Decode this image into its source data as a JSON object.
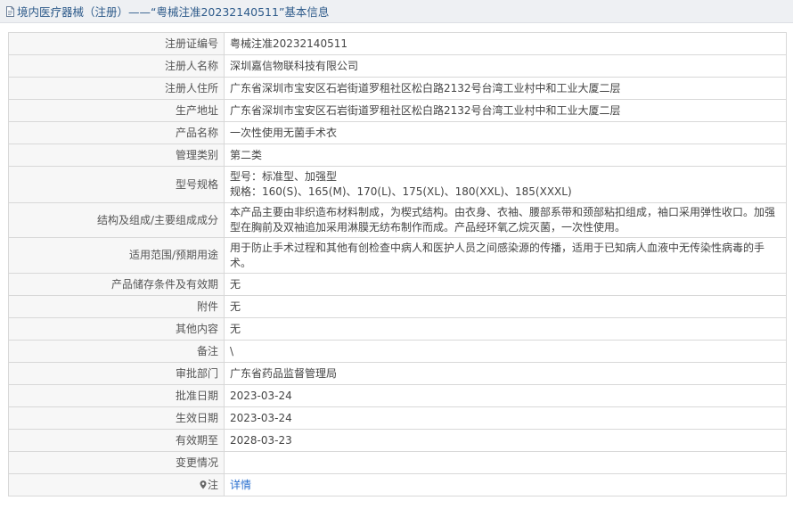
{
  "header": {
    "title": "境内医疗器械（注册）——“粤械注准20232140511”基本信息"
  },
  "rows": [
    {
      "label": "注册证编号",
      "value": "粤械注准20232140511"
    },
    {
      "label": "注册人名称",
      "value": "深圳嘉信物联科技有限公司"
    },
    {
      "label": "注册人住所",
      "value": "广东省深圳市宝安区石岩街道罗租社区松白路2132号台湾工业村中和工业大厦二层"
    },
    {
      "label": "生产地址",
      "value": "广东省深圳市宝安区石岩街道罗租社区松白路2132号台湾工业村中和工业大厦二层"
    },
    {
      "label": "产品名称",
      "value": "一次性使用无菌手术衣"
    },
    {
      "label": "管理类别",
      "value": "第二类"
    },
    {
      "label": "型号规格",
      "value_lines": [
        "型号：标准型、加强型",
        "规格：160(S)、165(M)、170(L)、175(XL)、180(XXL)、185(XXXL)"
      ]
    },
    {
      "label": "结构及组成/主要组成成分",
      "value": "本产品主要由非织造布材料制成，为楔式结构。由衣身、衣袖、腰部系带和颈部粘扣组成，袖口采用弹性收口。加强型在胸前及双袖追加采用淋膜无纺布制作而成。产品经环氧乙烷灭菌，一次性使用。"
    },
    {
      "label": "适用范围/预期用途",
      "value": "用于防止手术过程和其他有创检查中病人和医护人员之间感染源的传播，适用于已知病人血液中无传染性病毒的手术。"
    },
    {
      "label": "产品储存条件及有效期",
      "value": "无"
    },
    {
      "label": "附件",
      "value": "无"
    },
    {
      "label": "其他内容",
      "value": "无"
    },
    {
      "label": "备注",
      "value": "\\"
    },
    {
      "label": "审批部门",
      "value": "广东省药品监督管理局"
    },
    {
      "label": "批准日期",
      "value": "2023-03-24"
    },
    {
      "label": "生效日期",
      "value": "2023-03-24"
    },
    {
      "label": "有效期至",
      "value": "2028-03-23"
    },
    {
      "label": "变更情况",
      "value": ""
    },
    {
      "label": "注",
      "value": "详情"
    }
  ]
}
